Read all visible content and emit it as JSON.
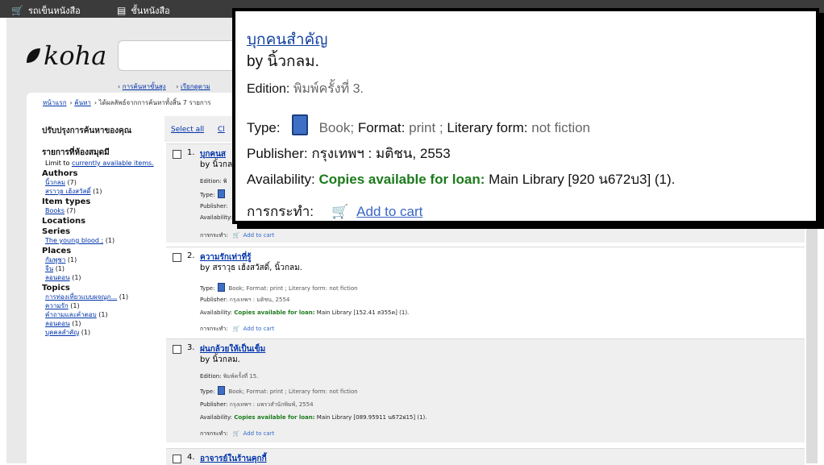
{
  "topbar": {
    "cart_label": "รถเข็นหนังสือ",
    "lists_label": "ชั้นหนังสือ"
  },
  "logo": "koha",
  "search": {
    "links": [
      "การค้นหาขั้นสูง",
      "เรียกดูตาม"
    ]
  },
  "breadcrumb": {
    "home": "หน้าแรก",
    "search": "ค้นหา",
    "results": "ได้ผลลัพธ์จากการค้นหาทั้งสิ้น 7 รายการ"
  },
  "sidebar": {
    "title": "ปรับปรุงการค้นหาของคุณ",
    "availability": {
      "heading": "รายการที่ห้องสมุดมี",
      "limit_text": "Limit to",
      "limit_link": "currently available items."
    },
    "facets": [
      {
        "heading": "Authors",
        "items": [
          {
            "label": "นิ้วกลม",
            "count": "(7)"
          },
          {
            "label": "สราวุธ เฮ้งสวัสดิ์",
            "count": "(1)"
          }
        ]
      },
      {
        "heading": "Item types",
        "items": [
          {
            "label": "Books",
            "count": "(7)"
          }
        ]
      },
      {
        "heading": "Locations",
        "items": []
      },
      {
        "heading": "Series",
        "items": [
          {
            "label": "The young blood ;",
            "count": "(1)"
          }
        ]
      },
      {
        "heading": "Places",
        "items": [
          {
            "label": "กัมพูชา",
            "count": "(1)"
          },
          {
            "label": "จีน",
            "count": "(1)"
          },
          {
            "label": "ลอนดอน",
            "count": "(1)"
          }
        ]
      },
      {
        "heading": "Topics",
        "items": [
          {
            "label": "การท่องเที่ยวแบบผจญภ...",
            "count": "(1)"
          },
          {
            "label": "ความรัก",
            "count": "(1)"
          },
          {
            "label": "คำถามและคำตอบ",
            "count": "(1)"
          },
          {
            "label": "ลอนดอน",
            "count": "(1)"
          },
          {
            "label": "บุคคลสำคัญ",
            "count": "(1)"
          }
        ]
      }
    ]
  },
  "toolbar": {
    "select_all": "Select all",
    "clear_all": "Cl"
  },
  "labels": {
    "type": "Type:",
    "book": "Book;",
    "format": "Format:",
    "format_value": "print ;",
    "literary": "Literary form:",
    "literary_value": "not fiction",
    "publisher": "Publisher:",
    "availability": "Availability:",
    "copies": "Copies available for loan:",
    "actions": "การกระทำ:",
    "add_to_cart": "Add to cart",
    "edition": "Edition:"
  },
  "results": [
    {
      "num": "1.",
      "title": "บุกคนส",
      "by": "by นิ้วกล",
      "edition": "พิ",
      "publisher": "",
      "avail": ""
    },
    {
      "num": "2.",
      "title": "ความรักเท่าที่รู้",
      "by": "by สราวุธ เฮ้งสวัสดิ์, นิ้วกลม.",
      "publisher_value": "กรุงเทพฯ : มติชน, 2554",
      "avail_value": "Main Library [152.41 ส355ค] (1)."
    },
    {
      "num": "3.",
      "title": "ฝนกล้วยให้เป็นเข็ม",
      "by": "by นิ้วกลม.",
      "edition_value": "พิมพ์ครั้งที่ 15.",
      "publisher_value": "กรุงเทพฯ : แพรวสำนักพิมพ์, 2554",
      "avail_value": "Main Library [089.95911 น672ฝ15] (1)."
    },
    {
      "num": "4.",
      "title": "อาจารย์ในร้านคุกกี้"
    }
  ],
  "zoom": {
    "title": "บุกคนสำคัญ",
    "by": "by นิ้วกลม.",
    "edition_value": "พิมพ์ครั้งที่ 3.",
    "publisher_value": "กรุงเทพฯ : มติชน, 2553",
    "avail_value": "Main Library [920 น672บ3] (1)."
  }
}
